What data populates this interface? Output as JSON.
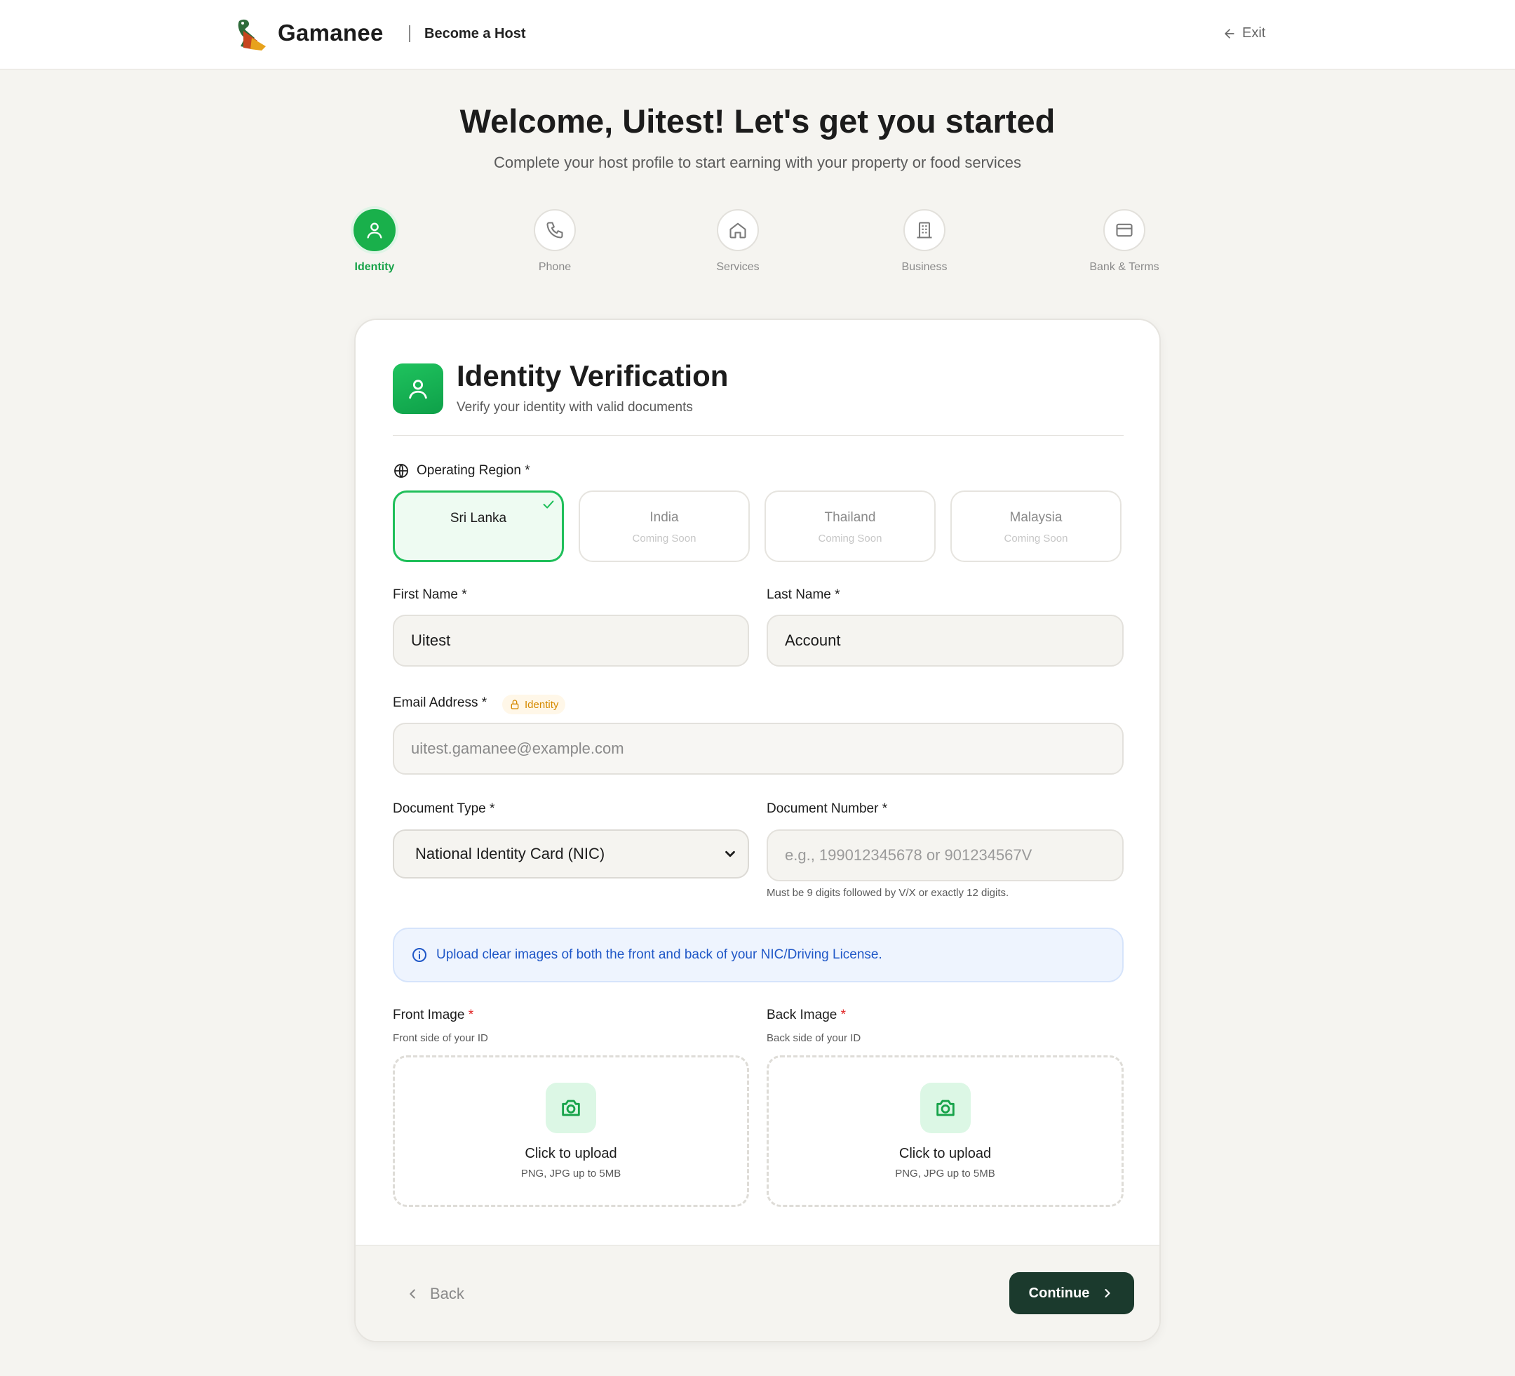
{
  "header": {
    "brand": "Gamanee",
    "section": "Become a Host",
    "exit_label": "Exit"
  },
  "hero": {
    "title": "Welcome, Uitest! Let's get you started",
    "subtitle": "Complete your host profile to start earning with your property or food services"
  },
  "steps": [
    {
      "label": "Identity",
      "icon": "user-icon",
      "active": true
    },
    {
      "label": "Phone",
      "icon": "phone-icon",
      "active": false
    },
    {
      "label": "Services",
      "icon": "home-icon",
      "active": false
    },
    {
      "label": "Business",
      "icon": "building-icon",
      "active": false
    },
    {
      "label": "Bank & Terms",
      "icon": "card-icon",
      "active": false
    }
  ],
  "card": {
    "title": "Identity Verification",
    "subtitle": "Verify your identity with valid documents"
  },
  "region": {
    "label": "Operating Region",
    "required": "*",
    "options": [
      {
        "name": "Sri Lanka",
        "status": "",
        "selected": true
      },
      {
        "name": "India",
        "status": "Coming Soon",
        "selected": false
      },
      {
        "name": "Thailand",
        "status": "Coming Soon",
        "selected": false
      },
      {
        "name": "Malaysia",
        "status": "Coming Soon",
        "selected": false
      }
    ]
  },
  "form": {
    "first_name_label": "First Name",
    "first_name_value": "Uitest",
    "last_name_label": "Last Name",
    "last_name_value": "Account",
    "email_label": "Email Address",
    "email_badge": "Identity",
    "email_value": "uitest.gamanee@example.com",
    "doc_type_label": "Document Type",
    "doc_type_value": "National Identity Card (NIC)",
    "doc_number_label": "Document Number",
    "doc_number_placeholder": "e.g., 199012345678 or 901234567V",
    "doc_number_hint": "Must be 9 digits followed by V/X or exactly 12 digits.",
    "required": "*"
  },
  "info": {
    "text": "Upload clear images of both the front and back of your NIC/Driving License."
  },
  "uploads": {
    "front_label": "Front Image",
    "front_sub": "Front side of your ID",
    "back_label": "Back Image",
    "back_sub": "Back side of your ID",
    "cta": "Click to upload",
    "formats": "PNG, JPG up to 5MB"
  },
  "footer": {
    "back_label": "Back",
    "continue_label": "Continue"
  },
  "colors": {
    "accent_green": "#19b04b",
    "continue_bg": "#1b3a2d",
    "info_blue": "#1f57c7",
    "badge_orange": "#d58a00"
  }
}
